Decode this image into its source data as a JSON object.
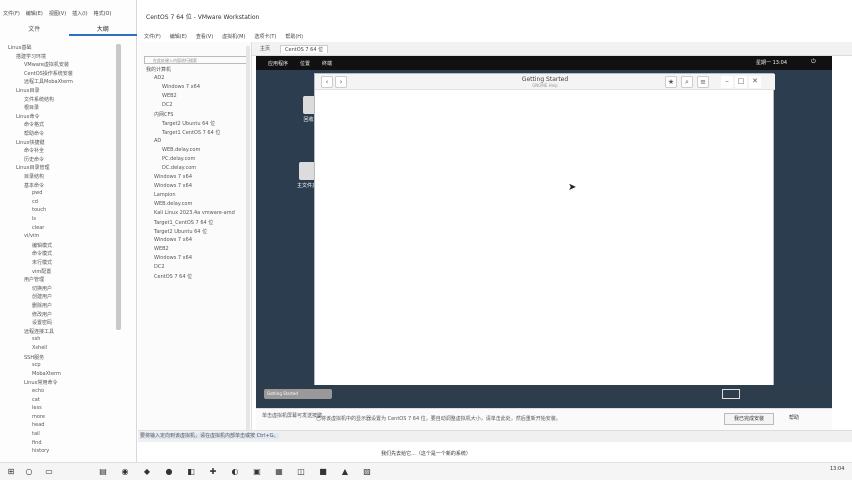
{
  "outline_app": {
    "menu": [
      "文件(F)",
      "编辑(E)",
      "视图(V)",
      "插入(I)",
      "格式(O)",
      "工具(T)",
      "帮助(H)"
    ],
    "tabs": [
      {
        "label": "文件"
      },
      {
        "label": "大纲"
      }
    ],
    "tree": [
      "Linux基础",
      "搭建学习环境",
      "VMware虚拟机安装",
      "CentOS操作系统安装",
      "远程工具MobaXterm",
      "Linux目录",
      "文件系统结构",
      "根目录",
      "Linux命令",
      "命令格式",
      "帮助命令",
      "Linux快捷键",
      "命令补全",
      "历史命令",
      "Linux目录管理",
      "目录结构",
      "基本命令",
      "pwd",
      "cd",
      "touch",
      "ls",
      "clear",
      "vi/vim",
      "编辑模式",
      "命令模式",
      "末行模式",
      "vim配置",
      "用户管理",
      "切换用户",
      "创建用户",
      "删除用户",
      "修改用户",
      "设置密码",
      "远程连接工具",
      "ssh",
      "Xshell",
      "SSH服务",
      "scp",
      "MobaXterm",
      "Linux常用命令",
      "echo",
      "cat",
      "less",
      "more",
      "head",
      "tail",
      "find",
      "history"
    ]
  },
  "vmware": {
    "title": "CentOS 7 64 位 - VMware Workstation",
    "menu": [
      "文件(F)",
      "编辑(E)",
      "查看(V)",
      "虚拟机(M)",
      "选项卡(T)",
      "帮助(H)"
    ],
    "library": {
      "search_placeholder": "在此处键入内容进行搜索",
      "items": [
        "我的计算机",
        "AD2",
        "Windows 7 x64",
        "WEB2",
        "DC2",
        "内网CFS",
        "Target2 Ubuntu 64 位",
        "Target1 CentOS 7 64 位",
        "AD",
        "WEB.delay.com",
        "PC.delay.com",
        "DC.delay.com",
        "Windows 7 x64",
        "Windows 7 x64",
        "Lampion",
        "WEB.delay.com",
        "Kali Linux 2023.4a vmware-amd",
        "Target1_CentOS 7 64 位",
        "Target2 Ubuntu 64 位",
        "Windows 7 x64",
        "WEB2",
        "Windows 7 x64",
        "DC2",
        "CentOS 7 64 位"
      ]
    },
    "tabs": [
      {
        "label": "主页"
      },
      {
        "label": "CentOS 7 64 位"
      }
    ],
    "gnome": {
      "menu": [
        "应用程序",
        "位置",
        "终端"
      ],
      "clock": "星期一 13:04"
    },
    "desktop_icons": [
      {
        "label": "回收站"
      },
      {
        "label": "主文件夹"
      }
    ],
    "dialog": {
      "title": "Getting Started",
      "subtitle": "GNOME Help"
    },
    "hint": {
      "short": "单击虚拟机屏幕可发送按键",
      "long": "已将该虚拟机中的显示器设置为 CentOS 7 64 位，要自动调整虚拟机大小，请单击此处，然后重新开始安装。",
      "install_button": "我已完成安装",
      "help_button": "帮助"
    },
    "status": "要将输入定向到该虚拟机，请在虚拟机内部单击或按 Ctrl+G。"
  },
  "caption": "我们先去给它...（这个是一个新的系统）",
  "taskbar": {
    "clock": "13:04"
  }
}
